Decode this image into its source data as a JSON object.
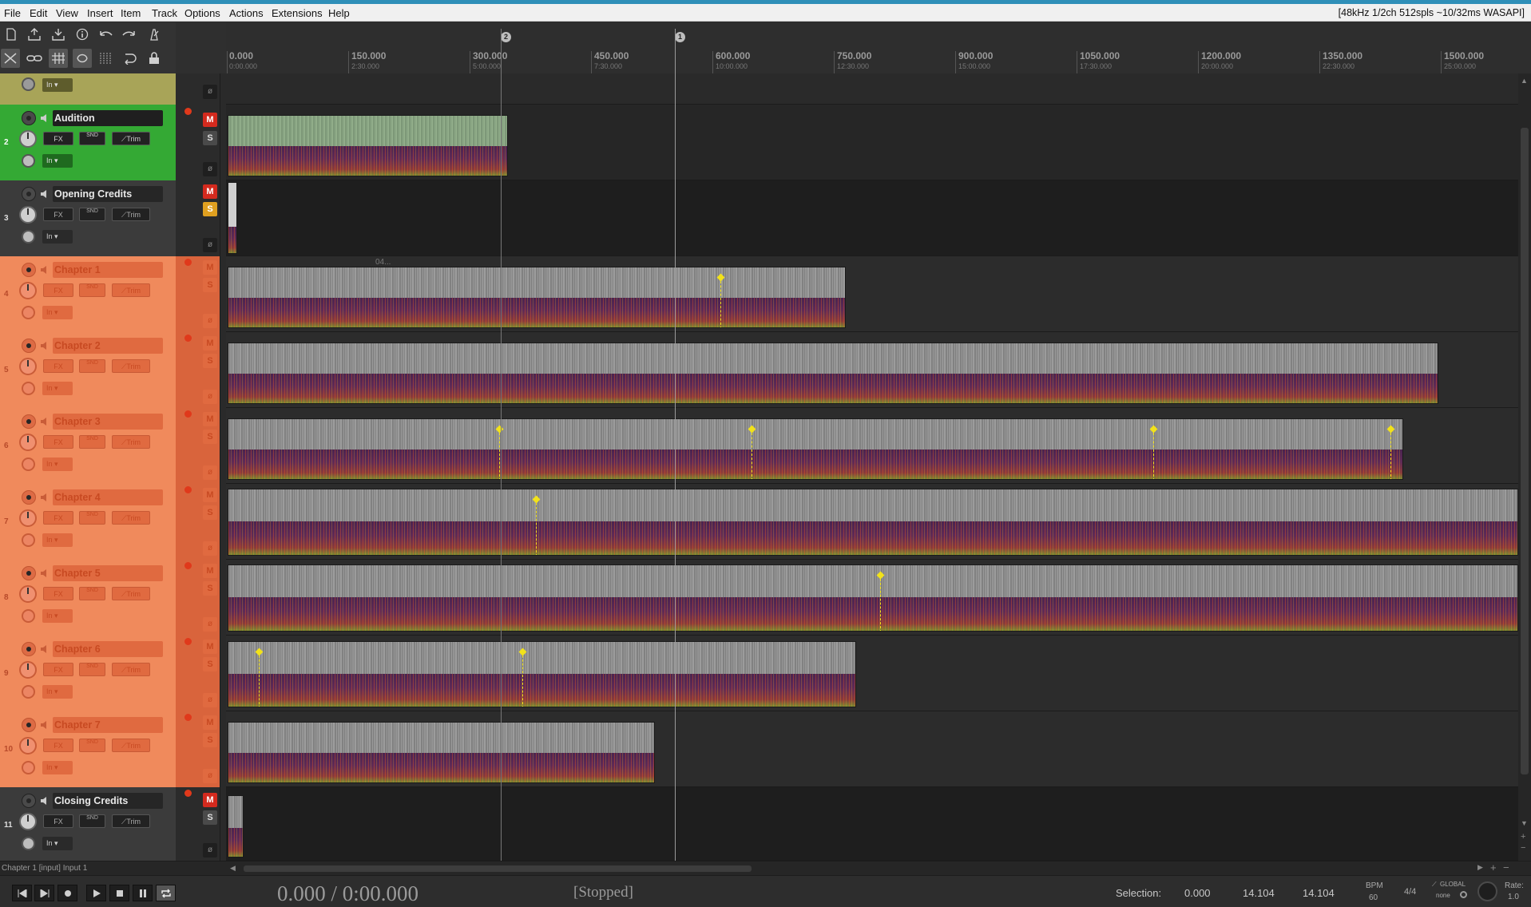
{
  "menubar": {
    "items": [
      "File",
      "Edit",
      "View",
      "Insert",
      "Item",
      "Track",
      "Options",
      "Actions",
      "Extensions",
      "Help"
    ],
    "audio_status": "[48kHz 1/2ch 512spls ~10/32ms WASAPI]"
  },
  "ruler": {
    "marks": [
      {
        "label": "0.000",
        "sub": "0:00.000"
      },
      {
        "label": "150.000",
        "sub": "2:30.000"
      },
      {
        "label": "300.000",
        "sub": "5:00.000"
      },
      {
        "label": "450.000",
        "sub": "7:30.000"
      },
      {
        "label": "600.000",
        "sub": "10:00.000"
      },
      {
        "label": "750.000",
        "sub": "12:30.000"
      },
      {
        "label": "900.000",
        "sub": "15:00.000"
      },
      {
        "label": "1050.000",
        "sub": "17:30.000"
      },
      {
        "label": "1200.000",
        "sub": "20:00.000"
      },
      {
        "label": "1350.000",
        "sub": "22:30.000"
      },
      {
        "label": "1500.000",
        "sub": "25:00.000"
      }
    ],
    "markers": [
      "2",
      "1"
    ]
  },
  "tcp_labels": {
    "fx": "FX",
    "snd": "SND",
    "trim": "Trim",
    "in": "In",
    "mute": "M",
    "solo": "S",
    "phase": "ø"
  },
  "tracks": [
    {
      "num": "",
      "name": "",
      "label_text": "",
      "color": "#a8a458"
    },
    {
      "num": "2",
      "name": "Audition",
      "label_text": "",
      "color": "#34a934"
    },
    {
      "num": "3",
      "name": "Opening Credits",
      "label_text": "",
      "color": "#4a4a4a"
    },
    {
      "num": "4",
      "name": "Chapter 1",
      "label_text": "04...",
      "color": "#f08a5c"
    },
    {
      "num": "5",
      "name": "Chapter 2",
      "label_text": "",
      "color": "#f08a5c"
    },
    {
      "num": "6",
      "name": "Chapter 3",
      "label_text": "",
      "color": "#f08a5c"
    },
    {
      "num": "7",
      "name": "Chapter 4",
      "label_text": "",
      "color": "#f08a5c"
    },
    {
      "num": "8",
      "name": "Chapter 5",
      "label_text": "",
      "color": "#f08a5c"
    },
    {
      "num": "9",
      "name": "Chapter 6",
      "label_text": "",
      "color": "#f08a5c"
    },
    {
      "num": "10",
      "name": "Chapter 7",
      "label_text": "",
      "color": "#f08a5c"
    },
    {
      "num": "11",
      "name": "Closing Credits",
      "label_text": "",
      "color": "#4a4a4a"
    }
  ],
  "status": {
    "text": "Chapter 1 [input] Input 1"
  },
  "transport": {
    "time": "0.000 / 0:00.000",
    "state": "[Stopped]",
    "selection_label": "Selection:",
    "sel_start": "0.000",
    "sel_end": "14.104",
    "sel_length": "14.104",
    "bpm_label": "BPM",
    "bpm": "60",
    "time_sig": "4/4",
    "global_label": "GLOBAL",
    "global_value": "none",
    "rate_label": "Rate:",
    "rate": "1.0"
  },
  "colors": {
    "chapter_tcp": "#f08a5c",
    "audition_tcp": "#34a934",
    "folder_tcp": "#a8a458",
    "mute_active": "#d42a1e",
    "solo_active": "#e0a020"
  }
}
